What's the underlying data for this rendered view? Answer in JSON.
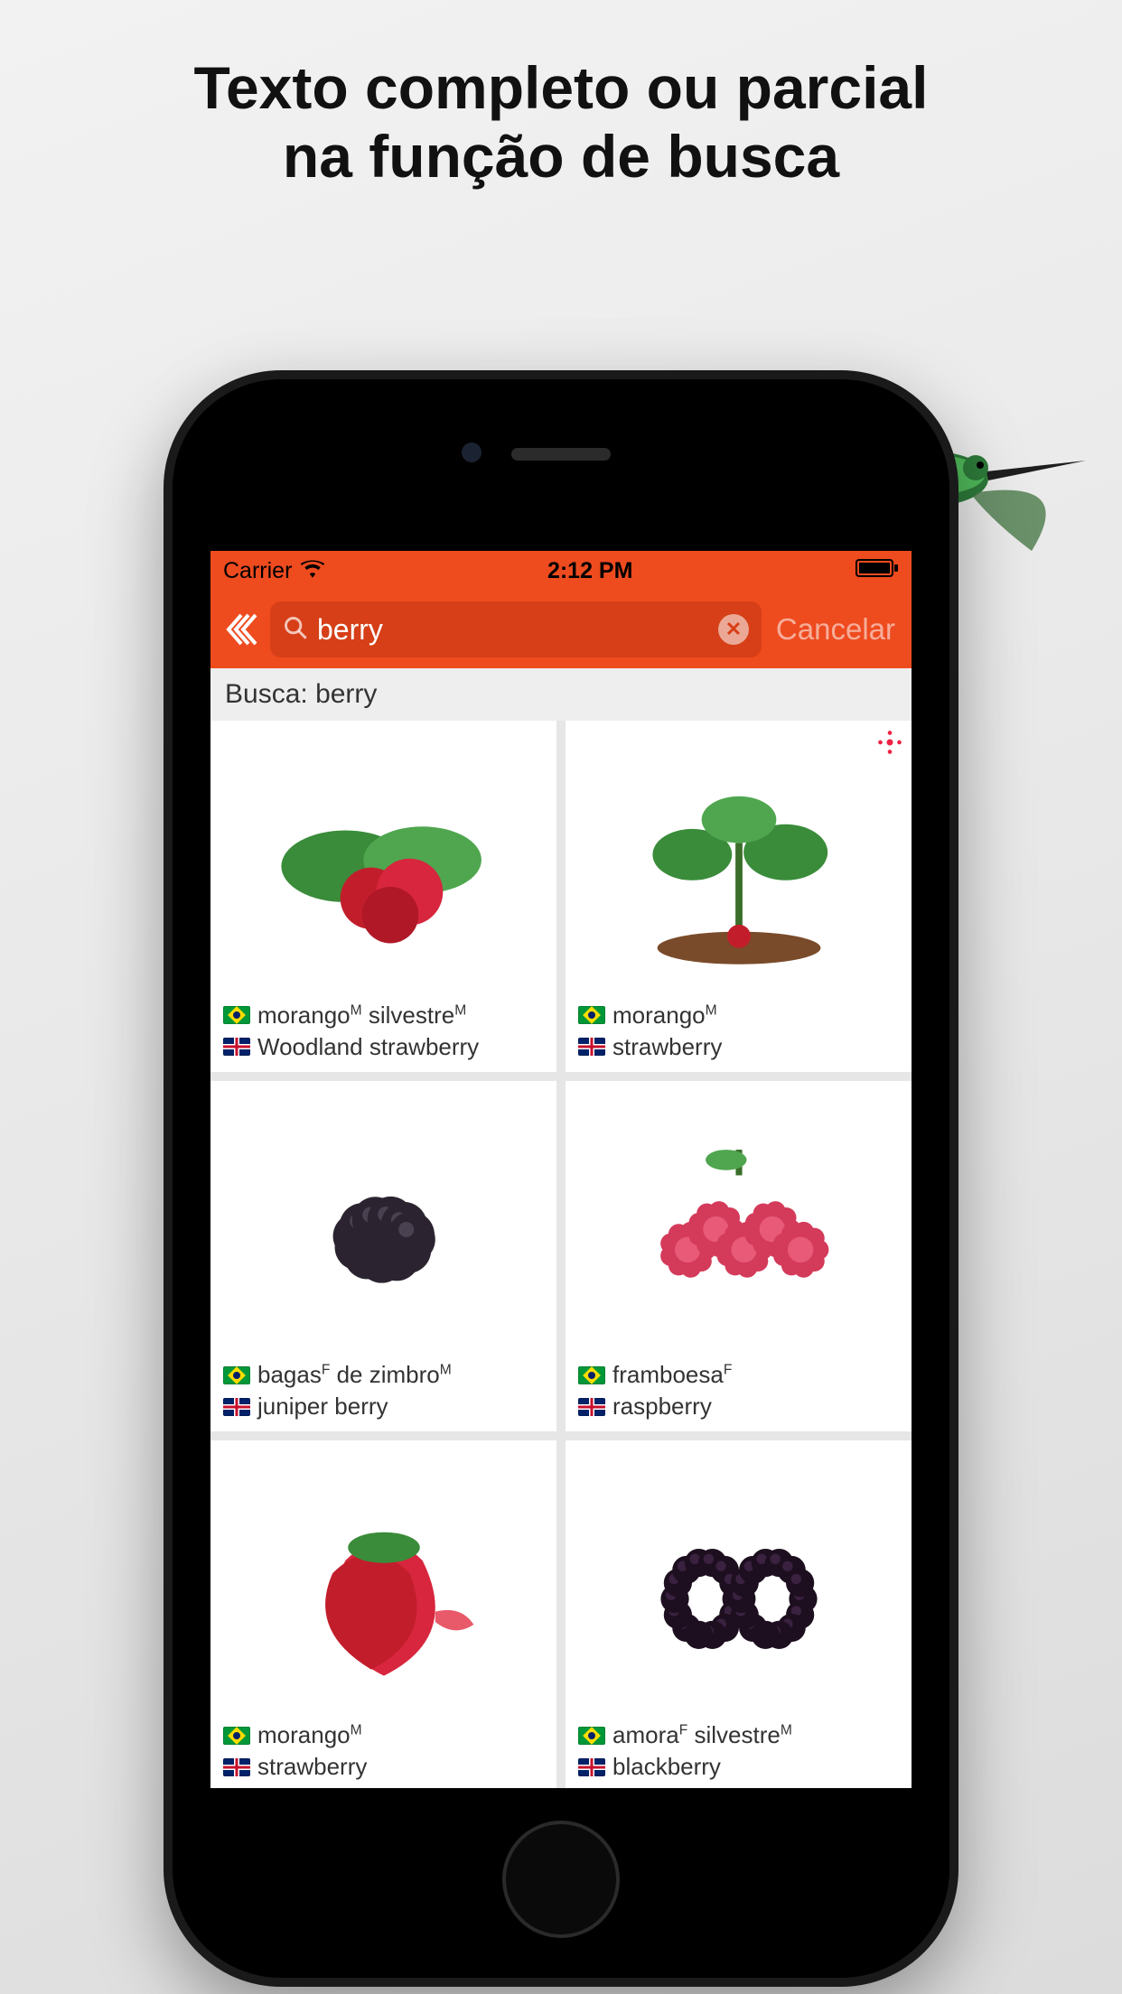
{
  "promo": {
    "line1": "Texto completo ou parcial",
    "line2": "na função de busca"
  },
  "statusbar": {
    "carrier": "Carrier",
    "time": "2:12 PM"
  },
  "navbar": {
    "search_value": "berry",
    "cancel_label": "Cancelar"
  },
  "results": {
    "header_prefix": "Busca:",
    "header_query": "berry",
    "items": [
      {
        "br_html": "morango<sup>M</sup> silvestre<sup>M</sup>",
        "en": "Woodland strawberry",
        "thumb": "wild-strawberry",
        "badge": false
      },
      {
        "br_html": "morango<sup>M</sup>",
        "en": "strawberry",
        "thumb": "strawberry-plant",
        "badge": true
      },
      {
        "br_html": "bagas<sup>F</sup> de zimbro<sup>M</sup>",
        "en": "juniper berry",
        "thumb": "juniper",
        "badge": false
      },
      {
        "br_html": "framboesa<sup>F</sup>",
        "en": "raspberry",
        "thumb": "raspberry",
        "badge": false
      },
      {
        "br_html": "morango<sup>M</sup>",
        "en": "strawberry",
        "thumb": "strawberry",
        "badge": false
      },
      {
        "br_html": "amora<sup>F</sup> silvestre<sup>M</sup>",
        "en": "blackberry",
        "thumb": "blackberry",
        "badge": false
      }
    ]
  }
}
